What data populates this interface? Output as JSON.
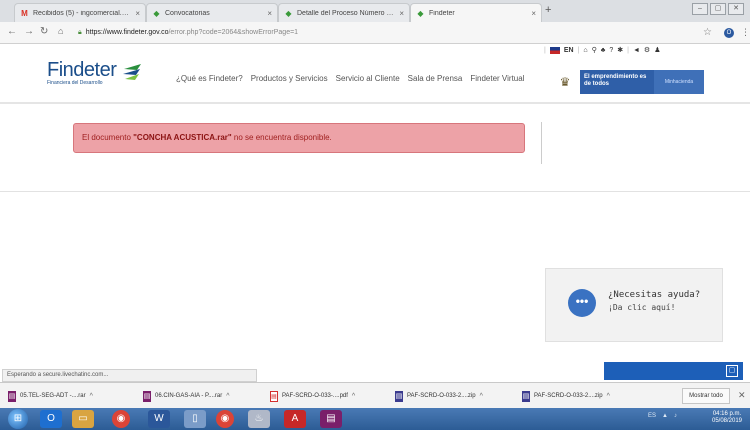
{
  "browser": {
    "tabs": [
      {
        "icon": "gmail-icon",
        "glyph": "M",
        "color": "#d93025",
        "title": "Recibidos (5) - ingcomercial.acu"
      },
      {
        "icon": "findeter-icon",
        "glyph": "◆",
        "color": "#3a9a3a",
        "title": "Convocatorias"
      },
      {
        "icon": "findeter-icon",
        "glyph": "◆",
        "color": "#3a9a3a",
        "title": "Detalle del Proceso Número PAF"
      },
      {
        "icon": "findeter-icon",
        "glyph": "◆",
        "color": "#3a9a3a",
        "title": "Findeter"
      }
    ],
    "close_glyph": "×",
    "new_tab": "+",
    "url": {
      "host": "https://www.findeter.gov.co",
      "path": "/error.php?code=2064&showErrorPage=1"
    }
  },
  "site": {
    "logo_word": "Findeter",
    "logo_sub": "Financiera del Desarrollo",
    "nav": [
      "¿Qué es Findeter?",
      "Productos y Servicios",
      "Servicio al Cliente",
      "Sala de Prensa",
      "Findeter Virtual"
    ],
    "lang": "EN",
    "banner_text": "El emprendimiento es de todos",
    "banner_ministry": "Minhacienda"
  },
  "alert": {
    "prefix": "El documento ",
    "filename": "\"CONCHA ACUSTICA.rar\"",
    "suffix": " no se encuentra disponible."
  },
  "chat": {
    "question": "¿Necesitas ayuda?",
    "subtitle": "¡Da clic aquí!",
    "bubble": "•••"
  },
  "status_text": "Esperando a secure.livechatinc.com...",
  "downloads": [
    {
      "name": "05.TEL-SEG-ADT -....rar",
      "kind": "rar"
    },
    {
      "name": "06.CIN-GAS-AIA - P....rar",
      "kind": "rar"
    },
    {
      "name": "PAF-SCRD-O-033-....pdf",
      "kind": "pdf"
    },
    {
      "name": "PAF-SCRD-O-033-2....zip",
      "kind": "zip"
    },
    {
      "name": "PAF-SCRD-O-033-2....zip",
      "kind": "zip"
    }
  ],
  "show_all": "Mostrar todo",
  "taskbar": {
    "tray_lang": "ES",
    "time": "04:16 p.m.",
    "date": "05/08/2019"
  },
  "colors": {
    "alert_bg": "#eda2a7",
    "brand_blue": "#1b4e8a",
    "chat_blue": "#3a72c2"
  }
}
